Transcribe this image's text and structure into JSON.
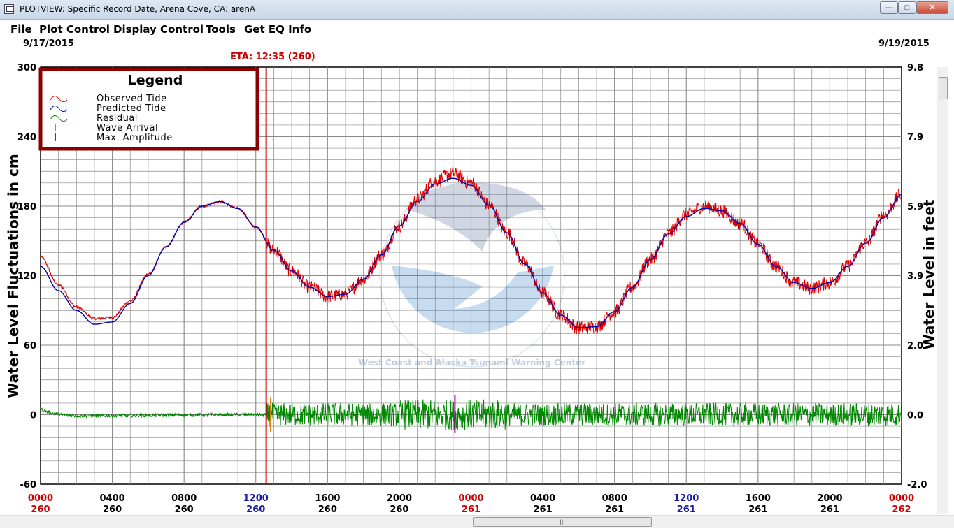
{
  "window": {
    "title": "PLOTVIEW: Specific Record Date, Arena Cove, CA: arenA",
    "controls": {
      "minimize": "—",
      "maximize": "□",
      "close": "✕"
    }
  },
  "menu": {
    "items": [
      "File",
      "Plot Control",
      "Display Control",
      "Tools",
      "Get EQ Info"
    ]
  },
  "header": {
    "start_date": "9/17/2015",
    "end_date": "9/19/2015",
    "eta_label": "ETA: 12:35 (260)"
  },
  "colors": {
    "observed": "#dd0000",
    "predicted": "#0000aa",
    "residual": "#008800",
    "wave_arrival": "#e08000",
    "max_amplitude": "#aa00aa",
    "eta_line": "#cc0000",
    "legend_border": "#8b0000",
    "grid": "#8a8a8a"
  },
  "legend": {
    "title": "Legend",
    "entries": [
      {
        "label": "Observed Tide",
        "icon": "wave-icon",
        "color_key": "observed"
      },
      {
        "label": "Predicted Tide",
        "icon": "wave-icon",
        "color_key": "predicted"
      },
      {
        "label": "Residual",
        "icon": "wave-icon",
        "color_key": "residual"
      },
      {
        "label": "Wave Arrival",
        "icon": "tick-icon",
        "color_key": "wave_arrival"
      },
      {
        "label": "Max. Amplitude",
        "icon": "tick-icon",
        "color_key": "max_amplitude"
      }
    ]
  },
  "watermark": {
    "icon": "noaa-logo-icon",
    "text": "West Coast and Alaska Tsunami Warning Center"
  },
  "chart_data": {
    "type": "line",
    "ylabel": "Water Level Fluctuations in cm",
    "ylabel_right": "Water Level in feet",
    "ylim": [
      -60,
      300
    ],
    "ylim_right": [
      -2.0,
      9.8
    ],
    "yticks": [
      "300",
      "240",
      "180",
      "120",
      "60",
      "0",
      "-60"
    ],
    "yticks_right": [
      "9.8",
      "7.9",
      "5.9",
      "3.9",
      "2.0",
      "0.0",
      "-2.0"
    ],
    "xlim_hours": [
      0,
      48
    ],
    "grid": true,
    "legend_position": "top-left",
    "xticks": [
      {
        "time": "0000",
        "day": "260",
        "style": "red"
      },
      {
        "time": "0400",
        "day": "260",
        "style": "black"
      },
      {
        "time": "0800",
        "day": "260",
        "style": "black"
      },
      {
        "time": "1200",
        "day": "260",
        "style": "blue"
      },
      {
        "time": "1600",
        "day": "260",
        "style": "black"
      },
      {
        "time": "2000",
        "day": "260",
        "style": "black"
      },
      {
        "time": "0000",
        "day": "261",
        "style": "red"
      },
      {
        "time": "0400",
        "day": "261",
        "style": "black"
      },
      {
        "time": "0800",
        "day": "261",
        "style": "black"
      },
      {
        "time": "1200",
        "day": "261",
        "style": "blue"
      },
      {
        "time": "1600",
        "day": "261",
        "style": "black"
      },
      {
        "time": "2000",
        "day": "261",
        "style": "black"
      },
      {
        "time": "0000",
        "day": "262",
        "style": "red"
      }
    ],
    "predicted_tide": {
      "name": "Predicted Tide",
      "hours": [
        0,
        1,
        2,
        3,
        4,
        5,
        6,
        7,
        8,
        9,
        10,
        11,
        12,
        13,
        14,
        15,
        16,
        17,
        18,
        19,
        20,
        21,
        22,
        23,
        24,
        25,
        26,
        27,
        28,
        29,
        30,
        31,
        32,
        33,
        34,
        35,
        36,
        37,
        38,
        39,
        40,
        41,
        42,
        43,
        44,
        45,
        46,
        47,
        48
      ],
      "cm": [
        128,
        107,
        90,
        78,
        80,
        96,
        120,
        145,
        166,
        180,
        184,
        178,
        162,
        142,
        124,
        110,
        102,
        104,
        117,
        138,
        163,
        184,
        199,
        204,
        198,
        181,
        157,
        130,
        105,
        86,
        75,
        76,
        89,
        110,
        134,
        156,
        171,
        178,
        176,
        165,
        147,
        128,
        114,
        109,
        114,
        128,
        148,
        170,
        190
      ]
    },
    "observed_tide": {
      "name": "Observed Tide",
      "hours": [
        0,
        1,
        2,
        3,
        4,
        5,
        6,
        7,
        8,
        9,
        10,
        11,
        12,
        13,
        14,
        15,
        16,
        17,
        18,
        19,
        20,
        21,
        22,
        23,
        24,
        25,
        26,
        27,
        28,
        29,
        30,
        31,
        32,
        33,
        34,
        35,
        36,
        37,
        38,
        39,
        40,
        41,
        42,
        43,
        44,
        45,
        46,
        47,
        48
      ],
      "cm": [
        136,
        112,
        93,
        83,
        84,
        98,
        121,
        145,
        166,
        180,
        184,
        178,
        162,
        142,
        124,
        110,
        102,
        104,
        117,
        138,
        163,
        186,
        202,
        208,
        200,
        181,
        157,
        130,
        105,
        86,
        75,
        76,
        89,
        110,
        134,
        156,
        173,
        180,
        176,
        165,
        147,
        128,
        114,
        109,
        114,
        128,
        148,
        172,
        190
      ]
    },
    "residual": {
      "name": "Residual",
      "quiet_until_hour": 12.6,
      "baseline_cm": 0,
      "noise_before_cm": 3,
      "noise_after_cm": 12
    },
    "eta_hour": 12.58,
    "wave_arrival_hour": 12.83,
    "max_amplitude_hour": 23.1
  }
}
